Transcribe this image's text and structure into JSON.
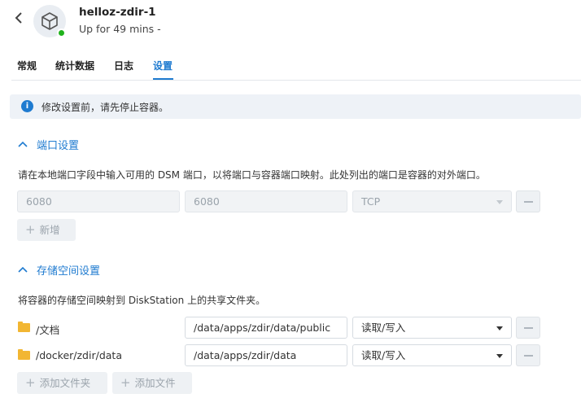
{
  "header": {
    "title": "helloz-zdir-1",
    "status": "Up for 49 mins -",
    "status_color": "#20b21c"
  },
  "tabs": [
    {
      "label": "常规"
    },
    {
      "label": "统计数据"
    },
    {
      "label": "日志"
    },
    {
      "label": "设置",
      "active": true
    }
  ],
  "info": {
    "icon": "info-icon",
    "text": "修改设置前，请先停止容器。"
  },
  "port_section": {
    "title": "端口设置",
    "description": "请在本地端口字段中输入可用的 DSM 端口，以将端口与容器端口映射。此处列出的端口是容器的对外端口。",
    "rows": [
      {
        "local_port": "6080",
        "container_port": "6080",
        "protocol": "TCP"
      }
    ],
    "add_label": "新增"
  },
  "storage_section": {
    "title": "存储空间设置",
    "description": "将容器的存储空间映射到 DiskStation 上的共享文件夹。",
    "rows": [
      {
        "folder": "/文档",
        "mount_path": "/data/apps/zdir/data/public",
        "permission": "读取/写入"
      },
      {
        "folder": "/docker/zdir/data",
        "mount_path": "/data/apps/zdir/data",
        "permission": "读取/写入"
      }
    ],
    "add_folder_label": "添加文件夹",
    "add_file_label": "添加文件"
  },
  "colors": {
    "accent": "#1f7bd0",
    "folder": "#f2b632"
  }
}
